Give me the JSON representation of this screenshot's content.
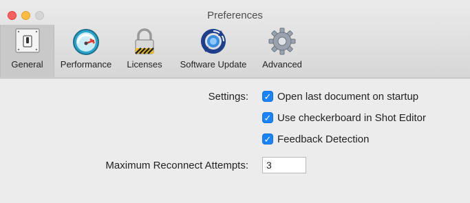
{
  "window": {
    "title": "Preferences"
  },
  "toolbar": {
    "tabs": [
      {
        "label": "General",
        "icon": "toggle-switch-icon",
        "selected": true
      },
      {
        "label": "Performance",
        "icon": "speedometer-icon",
        "selected": false
      },
      {
        "label": "Licenses",
        "icon": "padlock-icon",
        "selected": false
      },
      {
        "label": "Software Update",
        "icon": "sync-arrows-icon",
        "selected": false
      },
      {
        "label": "Advanced",
        "icon": "gear-icon",
        "selected": false
      }
    ]
  },
  "settings": {
    "label": "Settings:",
    "options": [
      {
        "label": "Open last document on startup",
        "checked": true
      },
      {
        "label": "Use checkerboard in Shot Editor",
        "checked": true
      },
      {
        "label": "Feedback Detection",
        "checked": true
      }
    ]
  },
  "reconnect": {
    "label": "Maximum Reconnect Attempts:",
    "value": "3"
  },
  "colors": {
    "checkbox_accent": "#1a82fb",
    "close_button": "#fc605c",
    "minimize_button": "#fdbc40",
    "zoom_button_inactive": "#d5d5d5"
  }
}
